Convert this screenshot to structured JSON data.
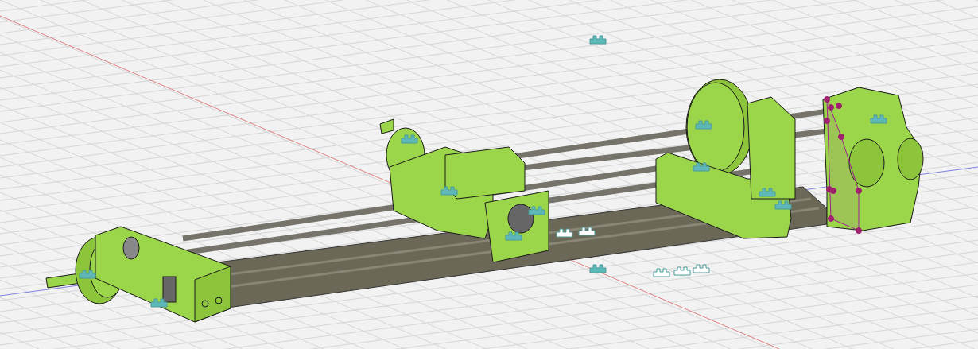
{
  "viewport": {
    "show_grid": true,
    "show_axes": true,
    "show_joint_markers": true,
    "show_sketch": true
  }
}
